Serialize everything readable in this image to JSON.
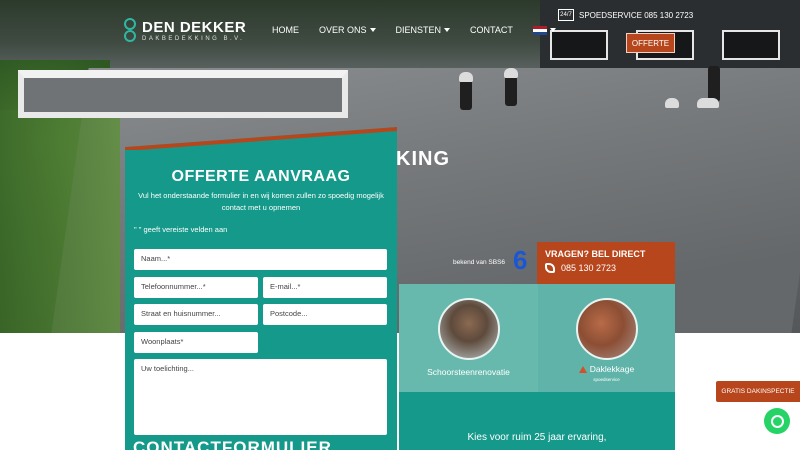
{
  "header": {
    "logo_name": "DEN DEKKER",
    "logo_sub": "DAKBEDEKKING B.V.",
    "nav": [
      {
        "label": "HOME",
        "dropdown": false
      },
      {
        "label": "OVER ONS",
        "dropdown": true
      },
      {
        "label": "DIENSTEN",
        "dropdown": true
      },
      {
        "label": "CONTACT",
        "dropdown": false
      }
    ],
    "language_flag": "nl-flag-icon",
    "spoed_icon_text": "24/7",
    "spoed_text": "SPOEDSERVICE 085 130 2723",
    "offerte_label": "OFFERTE"
  },
  "hero": {
    "title_fragment": "KING"
  },
  "form": {
    "title": "OFFERTE AANVRAAG",
    "intro": "Vul het onderstaande formulier in en wij komen zullen zo spoedig mogelijk contact met u opnemen",
    "required_note": "\" \" geeft vereiste velden aan",
    "fields": {
      "name": "Naam...*",
      "phone": "Telefoonnummer...*",
      "email": "E-mail...*",
      "street": "Straat en huisnummer...",
      "postcode": "Postcode...",
      "city": "Woonplaats*",
      "message": "Uw toelichting..."
    },
    "bottom_heading": "CONTACTFORMULIER"
  },
  "info": {
    "bekend_text": "bekend van SBS6",
    "sbs_logo": "6",
    "vragen_title": "VRAGEN? BEL DIRECT",
    "vragen_phone": "085 130 2723"
  },
  "cards": [
    {
      "label": "Schoorsteenrenovatie",
      "icon": "chimney-photo"
    },
    {
      "label": "Daklekkage",
      "sub": "spoedservice",
      "icon": "roof-tiles-photo"
    }
  ],
  "lower": {
    "text": "Kies voor ruim 25 jaar ervaring,"
  },
  "floating": {
    "gratis_label": "GRATIS DAKINSPECTIE",
    "whatsapp": "whatsapp-icon"
  },
  "colors": {
    "teal": "#15998a",
    "orange": "#b8461c",
    "light_teal": "#67b9ae"
  }
}
